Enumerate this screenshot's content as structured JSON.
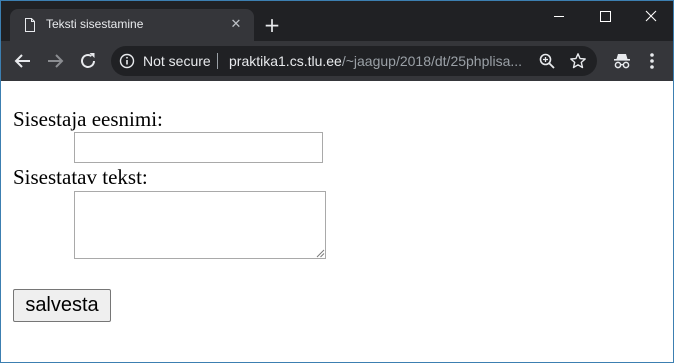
{
  "browser": {
    "tab": {
      "title": "Teksti sisestamine",
      "close_glyph": "✕"
    },
    "new_tab_glyph": "+",
    "omnibox": {
      "security_label": "Not secure",
      "url_host": "praktika1.cs.tlu.ee",
      "url_path": "/~jaagup/2018/dt/25phplisa..."
    },
    "colors": {
      "frame": "#202124",
      "toolbar": "#35363a",
      "window_border": "#3c7fb1"
    }
  },
  "form": {
    "name_label": "Sisestaja eesnimi:",
    "name_value": "",
    "text_label": "Sisestatav tekst:",
    "text_value": "",
    "submit_label": "salvesta"
  }
}
